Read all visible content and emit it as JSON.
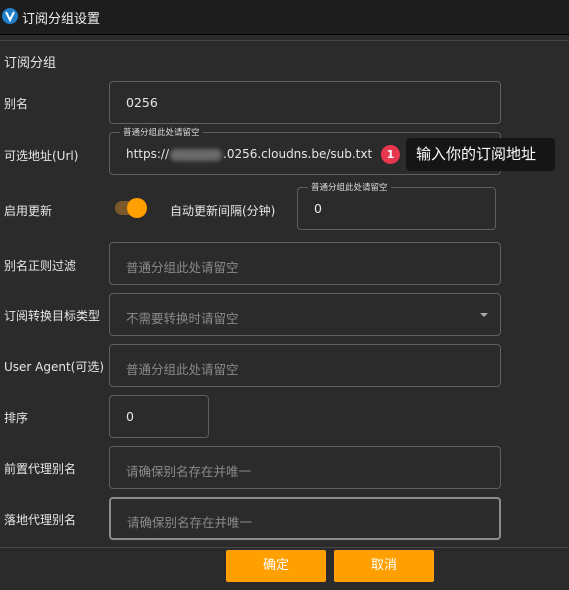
{
  "window": {
    "title": "订阅分组设置",
    "icon": "v2ray-logo-icon"
  },
  "section": {
    "title": "订阅分组"
  },
  "alias": {
    "label": "别名",
    "value": "0256"
  },
  "url": {
    "label": "可选地址(Url)",
    "float_label": "普通分组此处请留空",
    "value_prefix": "https://",
    "value_suffix": ".0256.cloudns.be/sub.txt",
    "badge": "1",
    "tooltip": "输入你的订阅地址"
  },
  "auto_update": {
    "label": "启用更新",
    "enabled": true,
    "interval_label": "自动更新间隔(分钟)",
    "interval_float_label": "普通分组此处请留空",
    "interval_value": "0"
  },
  "filter": {
    "label": "别名正则过滤",
    "placeholder": "普通分组此处请留空"
  },
  "convert": {
    "label": "订阅转换目标类型",
    "placeholder": "不需要转换时请留空"
  },
  "user_agent": {
    "label": "User Agent(可选)",
    "placeholder": "普通分组此处请留空"
  },
  "sort": {
    "label": "排序",
    "value": "0"
  },
  "prev_proxy": {
    "label": "前置代理别名",
    "placeholder": "请确保别名存在并唯一"
  },
  "landing_proxy": {
    "label": "落地代理别名",
    "placeholder": "请确保别名存在并唯一"
  },
  "buttons": {
    "ok": "确定",
    "cancel": "取消"
  },
  "colors": {
    "accent": "#ff9f00",
    "badge": "#e8384f",
    "background": "#2b2b2b"
  }
}
